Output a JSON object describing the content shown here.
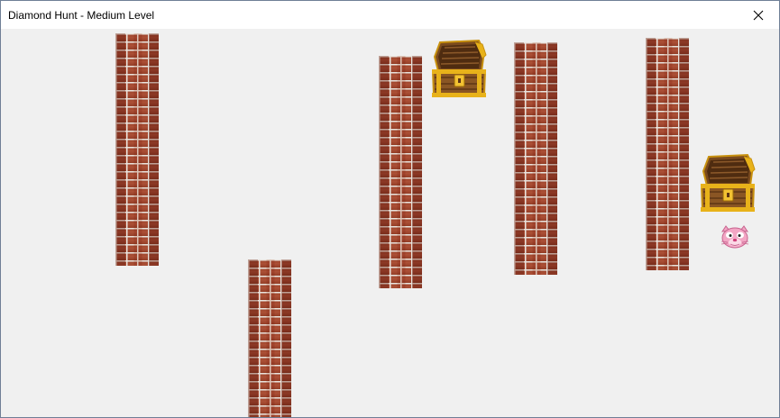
{
  "window": {
    "title": "Diamond Hunt - Medium Level"
  },
  "icons": {
    "close": "close-icon",
    "chest": "treasure-chest-icon",
    "player": "pink-panther-icon",
    "wall": "brick-wall"
  },
  "colors": {
    "background": "#f0f0f0",
    "brick": "#a8472c",
    "mortar": "#e9e4de",
    "chest_gold": "#e8b21a",
    "chest_wood": "#7a4a1e",
    "panther_pink": "#f2a6c4"
  },
  "game": {
    "walls": 5,
    "treasure_chests": 2,
    "players": 1
  }
}
